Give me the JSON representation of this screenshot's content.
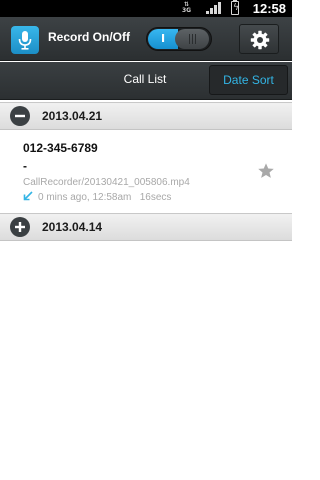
{
  "status_bar": {
    "network": "3G",
    "time": "12:58",
    "icons": [
      "signal-icon",
      "battery-charging-icon"
    ]
  },
  "action_bar": {
    "title": "Record On/Off",
    "toggle_label": "I",
    "toggle_state": "on",
    "icons": [
      "microphone-icon",
      "gear-icon"
    ],
    "accent_color": "#33b5e5"
  },
  "tabs": {
    "call_list": "Call List",
    "date_sort": "Date Sort"
  },
  "groups": [
    {
      "date": "2013.04.21",
      "expanded": true,
      "items": [
        {
          "number": "012-345-6789",
          "name": "-",
          "file": "CallRecorder/20130421_005806.mp4",
          "time_ago": "0 mins ago, 12:58am",
          "duration": "16secs",
          "direction": "incoming"
        }
      ]
    },
    {
      "date": "2013.04.14",
      "expanded": false,
      "items": []
    }
  ]
}
